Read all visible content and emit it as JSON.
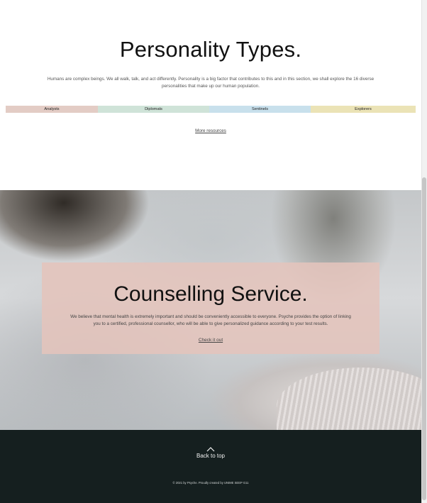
{
  "personality": {
    "title": "Personality Types.",
    "description": "Humans are complex beings. We all walk, talk, and act differently. Personality is a big factor that contributes to this and in this section, we shall explore the 16 diverse personalities that make up our human population.",
    "types": [
      {
        "label": "Analysts",
        "color": "#e3ccc5"
      },
      {
        "label": "Diplomats",
        "color": "#cfe3d8"
      },
      {
        "label": "Sentinels",
        "color": "#c8e0ec"
      },
      {
        "label": "Explorers",
        "color": "#ebe3b6"
      }
    ],
    "more_link": "More resources"
  },
  "counselling": {
    "title": "Counselling Service.",
    "description": "We believe that mental health is extremely important and should be conveniently accessible to everyone. Psyche provides the option of linking you to a certified, professional counsellor, who will be able to give personalized guidance according to your test results.",
    "link": "Check it out",
    "card_color": "#e4c4bc"
  },
  "footer": {
    "back_to_top": "Back to top",
    "copyright": "© 2021 by Psyche. Proudly created by UNIME SEEP G11",
    "icon": "chevron-up-icon",
    "background": "#151f1f"
  }
}
